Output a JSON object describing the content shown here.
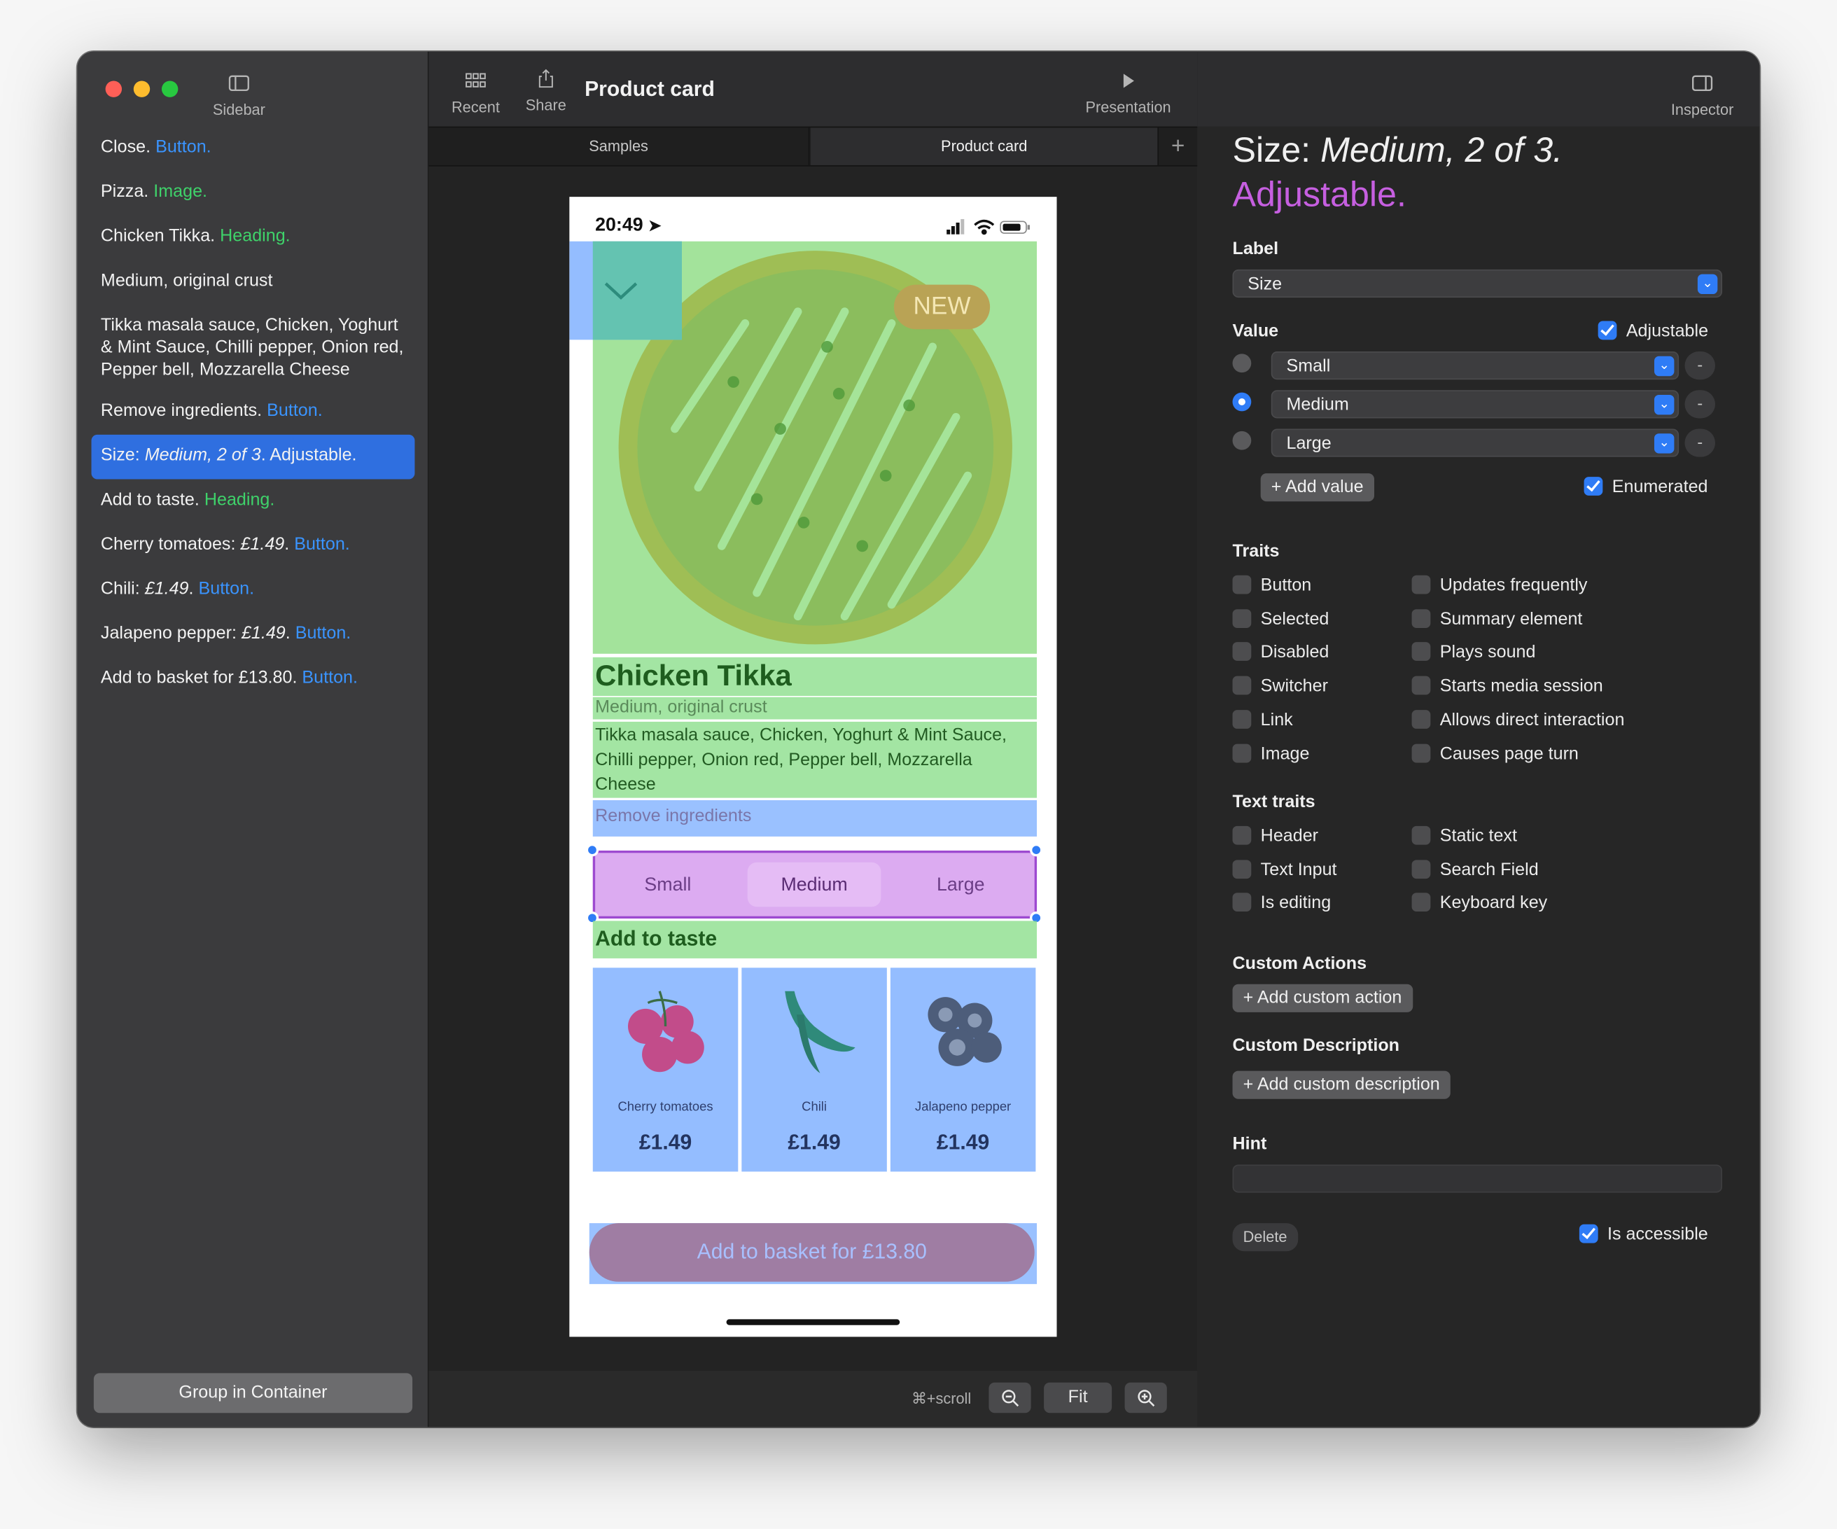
{
  "colors": {
    "accent": "#2f7cf6",
    "button_kind": "#3a94ff",
    "heading_kind": "#3fd26a",
    "adjustable": "#c65fe0"
  },
  "toolbar": {
    "sidebar_label": "Sidebar",
    "recent_label": "Recent",
    "share_label": "Share",
    "title": "Product card",
    "presentation_label": "Presentation",
    "inspector_label": "Inspector"
  },
  "tabs": [
    {
      "label": "Samples"
    },
    {
      "label": "Product card"
    }
  ],
  "sidebar": {
    "items": [
      {
        "text": "Close.",
        "kind": "Button."
      },
      {
        "text": "Pizza.",
        "kind": "Image."
      },
      {
        "text": "Chicken Tikka.",
        "kind": "Heading."
      },
      {
        "text": "Medium, original crust",
        "kind": ""
      },
      {
        "text": "Tikka masala sauce, Chicken, Yoghurt & Mint Sauce, Chilli pepper, Onion red, Pepper bell, Mozzarella Cheese",
        "kind": ""
      },
      {
        "text": "Remove ingredients.",
        "kind": "Button."
      },
      {
        "pre": "Size: ",
        "italic": "Medium, 2 of 3",
        "post": ". Adjustable."
      },
      {
        "text": "Add to taste.",
        "kind": "Heading."
      },
      {
        "pre": "Cherry tomatoes: ",
        "italic": "£1.49",
        "post": ".",
        "kind": "Button."
      },
      {
        "pre": "Chili: ",
        "italic": "£1.49",
        "post": ".",
        "kind": "Button."
      },
      {
        "pre": "Jalapeno pepper: ",
        "italic": "£1.49",
        "post": ".",
        "kind": "Button."
      },
      {
        "text": "Add to basket for £13.80.",
        "kind": "Button."
      }
    ],
    "group_button": "Group in Container"
  },
  "phone": {
    "time": "20:49",
    "badge": "NEW",
    "title": "Chicken Tikka",
    "subtitle": "Medium, original crust",
    "ingredients": "Tikka masala sauce, Chicken, Yoghurt & Mint Sauce, Chilli pepper, Onion red, Pepper bell, Mozzarella Cheese",
    "remove": "Remove ingredients",
    "sizes": [
      "Small",
      "Medium",
      "Large"
    ],
    "add_to_taste": "Add to taste",
    "toppings": [
      {
        "name": "Cherry tomatoes",
        "price": "£1.49"
      },
      {
        "name": "Chili",
        "price": "£1.49"
      },
      {
        "name": "Jalapeno pepper",
        "price": "£1.49"
      }
    ],
    "basket": "Add to basket for £13.80"
  },
  "bottom": {
    "hint": "⌘+scroll",
    "fit": "Fit"
  },
  "inspector": {
    "title_pre": "Size: ",
    "title_italic": "Medium, 2 of 3.",
    "title_adj": "Adjustable.",
    "label_section": "Label",
    "label_value": "Size",
    "value_section": "Value",
    "adjustable_label": "Adjustable",
    "values": [
      "Small",
      "Medium",
      "Large"
    ],
    "add_value": "+ Add value",
    "enumerated_label": "Enumerated",
    "traits_section": "Traits",
    "traits_left": [
      "Button",
      "Selected",
      "Disabled",
      "Switcher",
      "Link",
      "Image"
    ],
    "traits_right": [
      "Updates frequently",
      "Summary element",
      "Plays sound",
      "Starts media session",
      "Allows direct interaction",
      "Causes page turn"
    ],
    "text_traits_section": "Text traits",
    "text_traits_left": [
      "Header",
      "Text Input",
      "Is editing"
    ],
    "text_traits_right": [
      "Static text",
      "Search Field",
      "Keyboard key"
    ],
    "custom_actions_section": "Custom Actions",
    "add_custom_action": "+ Add custom action",
    "custom_description_section": "Custom Description",
    "add_custom_description": "+ Add custom description",
    "hint_section": "Hint",
    "delete_label": "Delete",
    "accessible_label": "Is accessible"
  }
}
